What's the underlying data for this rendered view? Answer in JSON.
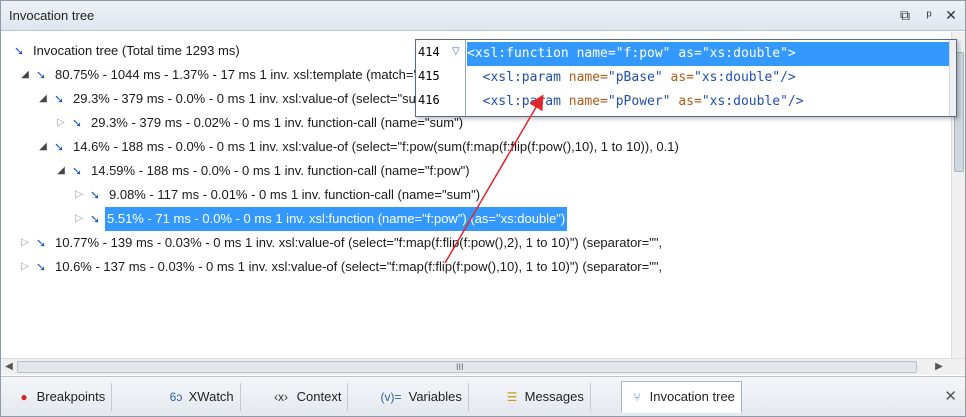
{
  "window": {
    "title": "Invocation tree",
    "controls": [
      "restore",
      "pin",
      "close"
    ]
  },
  "tree": {
    "rows": [
      {
        "label": "Invocation tree (Total time  1293 ms)",
        "expanded": true,
        "twisty": "none"
      },
      {
        "label": "80.75% - 1044 ms - 1.37% - 17 ms 1 inv. xsl:template (match=\"/\")",
        "expanded": true,
        "twisty": "open"
      },
      {
        "label": "29.3% - 379 ms - 0.0% - 0 ms 1 inv. xsl:value-of (select=\"sum(f:map(f:flip(f:pow(),10), 1 to 10))\") (separator=\"",
        "expanded": true,
        "twisty": "open"
      },
      {
        "label": "29.3% - 379 ms - 0.02% - 0 ms 1 inv. function-call (name=\"sum\")",
        "expanded": false,
        "twisty": "closed"
      },
      {
        "label": "14.6% - 188 ms - 0.0% - 0 ms 1 inv. xsl:value-of (select=\"f:pow(sum(f:map(f:flip(f:pow(),10), 1 to 10)), 0.1)",
        "expanded": true,
        "twisty": "open"
      },
      {
        "label": "14.59% - 188 ms - 0.0% - 0 ms 1 inv. function-call (name=\"f:pow\")",
        "expanded": true,
        "twisty": "open"
      },
      {
        "label": "9.08% - 117 ms - 0.01% - 0 ms 1 inv. function-call (name=\"sum\")",
        "expanded": false,
        "twisty": "closed"
      },
      {
        "label": "5.51% - 71 ms - 0.0% - 0 ms 1 inv. xsl:function (name=\"f:pow\") (as=\"xs:double\")",
        "expanded": false,
        "twisty": "closed",
        "selected": true
      },
      {
        "label": "10.77% - 139 ms - 0.03% - 0 ms 1 inv. xsl:value-of (select=\"f:map(f:flip(f:pow(),2), 1 to 10)\") (separator=\"\",",
        "expanded": false,
        "twisty": "closed"
      },
      {
        "label": "10.6% - 137 ms - 0.03% - 0 ms 1 inv. xsl:value-of (select=\"f:map(f:flip(f:pow(),10), 1 to 10)\") (separator=\"\",",
        "expanded": false,
        "twisty": "closed"
      },
      {
        "label": "",
        "expanded": false,
        "twisty": "none"
      }
    ]
  },
  "scroll": {
    "grip": "III"
  },
  "popup": {
    "lines": [
      {
        "number": "414",
        "fold": "▽",
        "tag_open": "<xsl:function ",
        "attr1": "name=",
        "val1": "\"f:pow\"",
        "attr2": " as=",
        "val2": "\"xs:double\"",
        "tag_close": ">"
      },
      {
        "number": "415",
        "fold": "",
        "tag_open": "  <xsl:param ",
        "attr1": "name=",
        "val1": "\"pBase\"",
        "attr2": " as=",
        "val2": "\"xs:double\"",
        "tag_close": "/>"
      },
      {
        "number": "416",
        "fold": "",
        "tag_open": "  <xsl:param ",
        "attr1": "name=",
        "val1": "\"pPower\"",
        "attr2": " as=",
        "val2": "\"xs:double\"",
        "tag_close": "/>"
      }
    ]
  },
  "tabs": [
    {
      "label": "Breakpoints",
      "icon": "breakpoints-icon",
      "glyph": "●",
      "active": false
    },
    {
      "label": "XWatch",
      "icon": "xwatch-icon",
      "glyph": "6ↄ",
      "active": false
    },
    {
      "label": "Context",
      "icon": "context-icon",
      "glyph": "‹x›",
      "active": false
    },
    {
      "label": "Variables",
      "icon": "variables-icon",
      "glyph": "(v)=",
      "active": false
    },
    {
      "label": "Messages",
      "icon": "messages-icon",
      "glyph": "☰",
      "active": false
    },
    {
      "label": "Invocation tree",
      "icon": "invocation-tree-icon",
      "glyph": "⑂",
      "active": true
    }
  ],
  "colors": {
    "selection": "#3399ff",
    "arrow": "#e0262b"
  }
}
